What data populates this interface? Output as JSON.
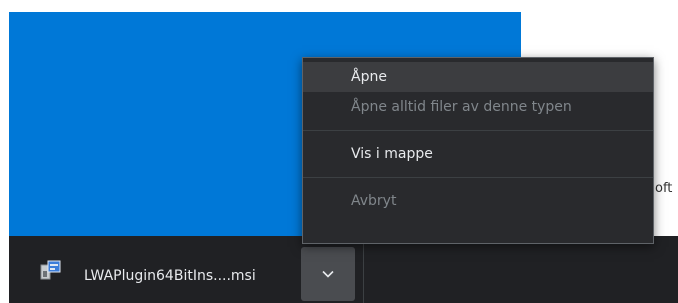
{
  "background": {
    "partial_text": "oft"
  },
  "download_bar": {
    "item_name": "LWAPlugin64BitIns....msi",
    "icons": {
      "file": "installer-file-icon",
      "menu_toggle": "chevron-down-icon"
    }
  },
  "context_menu": {
    "open": "Åpne",
    "always_open": "Åpne alltid filer av denne typen",
    "show_in_folder": "Vis i mappe",
    "cancel": "Avbryt"
  },
  "colors": {
    "accent_blue": "#0078d7",
    "menu_bg": "#292a2d",
    "bar_bg": "#202124",
    "text": "#e8eaed",
    "text_disabled": "#80868b"
  }
}
